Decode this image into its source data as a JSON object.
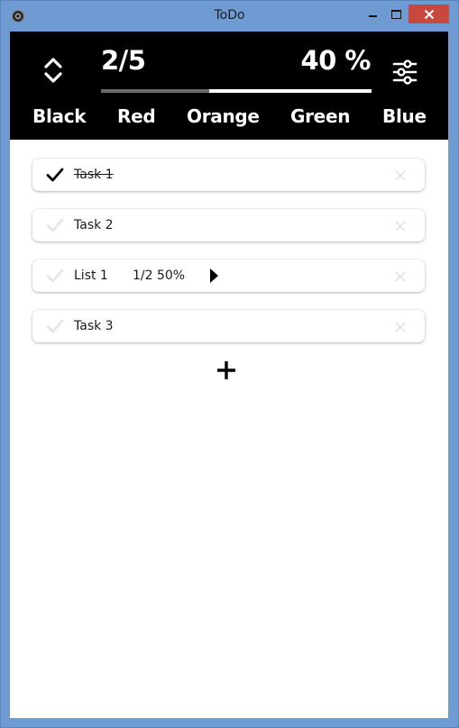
{
  "window": {
    "title": "ToDo"
  },
  "header": {
    "completed_count": "2/5",
    "completed_percent": "40 %",
    "progress_fraction": 0.4,
    "color_tabs": [
      "Black",
      "Red",
      "Orange",
      "Green",
      "Blue"
    ]
  },
  "items": [
    {
      "label": "Task 1",
      "done": true
    },
    {
      "label": "Task 2",
      "done": false
    },
    {
      "label": "List 1",
      "done": false,
      "progress": "1/2 50%"
    },
    {
      "label": "Task 3",
      "done": false
    }
  ],
  "icons": {
    "sort": "sort-updown-icon",
    "settings": "sliders-icon",
    "check": "checkmark-icon",
    "delete": "close-icon",
    "expand": "play-arrow-icon",
    "add": "plus-icon"
  },
  "colors": {
    "header_bg": "#000000",
    "check_done": "#000000",
    "check_undone": "#e6e6e6",
    "window_close": "#c9483d"
  }
}
